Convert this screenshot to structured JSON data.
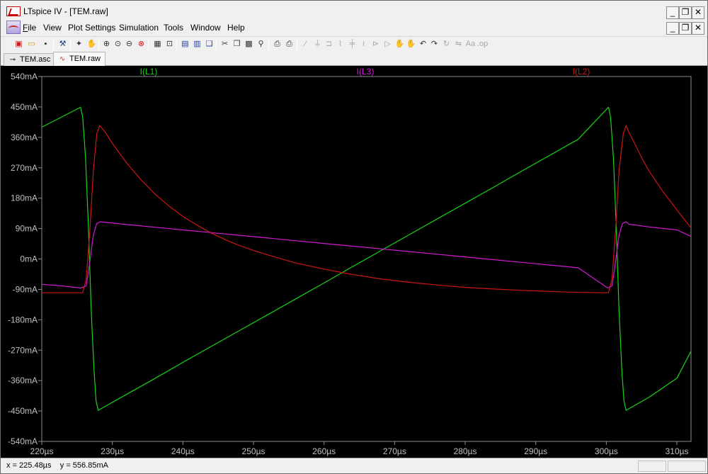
{
  "window": {
    "title": "LTspice IV - [TEM.raw]",
    "minimize": "_",
    "restore": "❐",
    "close": "✕"
  },
  "menu": [
    "File",
    "View",
    "Plot Settings",
    "Simulation",
    "Tools",
    "Window",
    "Help"
  ],
  "toolbar": {
    "icons": [
      "new-schematic",
      "open",
      "save",
      "control-panel",
      "run",
      "zoom-in",
      "pan",
      "zoom-out",
      "zoom-cancel",
      "autorange",
      "zoom-fit",
      "tile-horizontal",
      "tile-vertical",
      "cascade",
      "cut",
      "copy",
      "paste",
      "find",
      "print-preview",
      "print",
      "wire",
      "ground",
      "label",
      "resistor",
      "capacitor",
      "inductor",
      "diode",
      "component",
      "move",
      "drag",
      "undo",
      "redo",
      "rotate",
      "mirror",
      "text",
      "spice-directive"
    ]
  },
  "tabs": [
    {
      "label": "TEM.asc",
      "icon": "schematic-icon",
      "active": false
    },
    {
      "label": "TEM.raw",
      "icon": "waveform-icon",
      "active": true
    }
  ],
  "status": {
    "x_readout": "x = 225.48µs",
    "y_readout": "y = 556.85mA"
  },
  "colors": {
    "background": "#000000",
    "grid": "#8c8c8c",
    "axis_text": "#c0c0c0",
    "il1": "#19d219",
    "il3": "#d21ad2",
    "il2": "#cc1616"
  },
  "chart_data": {
    "type": "line",
    "xlabel": "",
    "ylabel": "",
    "x_unit": "µs",
    "y_unit": "mA",
    "xlim": [
      220,
      312
    ],
    "ylim": [
      -540,
      540
    ],
    "grid": false,
    "legend": "top",
    "x_ticks": [
      "220µs",
      "230µs",
      "240µs",
      "250µs",
      "260µs",
      "270µs",
      "280µs",
      "290µs",
      "300µs",
      "310µs"
    ],
    "x_tick_values": [
      220,
      230,
      240,
      250,
      260,
      270,
      280,
      290,
      300,
      310
    ],
    "y_ticks": [
      "540mA",
      "450mA",
      "360mA",
      "270mA",
      "180mA",
      "90mA",
      "0mA",
      "-90mA",
      "-180mA",
      "-270mA",
      "-360mA",
      "-450mA",
      "-540mA"
    ],
    "y_tick_values": [
      540,
      450,
      360,
      270,
      180,
      90,
      0,
      -90,
      -180,
      -270,
      -360,
      -450,
      -540
    ],
    "series": [
      {
        "name": "I(L1)",
        "color": "#19d219",
        "x": [
          220,
          225.5,
          225.8,
          226.2,
          226.6,
          227,
          227.4,
          227.7,
          228,
          232,
          236,
          240,
          244,
          248,
          252,
          256,
          260,
          264,
          268,
          272,
          276,
          280,
          284,
          288,
          292,
          296,
          300.3,
          300.6,
          301,
          301.4,
          301.8,
          302.2,
          302.5,
          302.8,
          306,
          310,
          313
        ],
        "y": [
          390,
          449,
          420,
          300,
          100,
          -150,
          -330,
          -420,
          -448,
          -401,
          -354,
          -306,
          -259,
          -212,
          -165,
          -118,
          -71,
          -23,
          24,
          71,
          118,
          165,
          212,
          260,
          307,
          354,
          449,
          420,
          300,
          100,
          -150,
          -330,
          -420,
          -448,
          -410,
          -353,
          -233
        ]
      },
      {
        "name": "I(L3)",
        "color": "#d21ad2",
        "x": [
          220,
          223,
          225.5,
          226.3,
          226.8,
          227.3,
          227.8,
          228.3,
          232,
          236,
          240,
          244,
          248,
          252,
          256,
          260,
          264,
          268,
          272,
          276,
          280,
          284,
          288,
          292,
          296,
          300.2,
          300.8,
          301.3,
          301.8,
          302.3,
          302.8,
          303.2,
          306,
          310,
          313
        ],
        "y": [
          -75,
          -80,
          -86,
          -80,
          -10,
          70,
          105,
          110,
          102,
          94,
          86,
          78,
          70,
          62,
          54,
          46,
          38,
          30,
          22,
          14,
          6,
          -2,
          -10,
          -18,
          -26,
          -86,
          -80,
          -10,
          70,
          105,
          110,
          103,
          95,
          86,
          57
        ]
      },
      {
        "name": "I(L2)",
        "color": "#cc1616",
        "x": [
          220,
          224,
          225.8,
          226.3,
          226.8,
          227.3,
          227.8,
          228.2,
          229,
          230,
          232,
          234,
          236,
          238,
          240,
          242,
          244,
          246,
          248,
          250,
          253,
          256,
          260,
          264,
          268,
          272,
          276,
          280,
          284,
          288,
          292,
          296,
          300.3,
          300.8,
          301.3,
          301.8,
          302.4,
          302.8,
          303.2,
          304,
          305,
          306,
          308,
          310,
          312,
          313
        ],
        "y": [
          -100,
          -100,
          -100,
          -60,
          80,
          260,
          370,
          395,
          375,
          342,
          285,
          236,
          193,
          157,
          126,
          100,
          77,
          57,
          40,
          25,
          6,
          -12,
          -30,
          -46,
          -59,
          -69,
          -77,
          -84,
          -89,
          -93,
          -96,
          -99,
          -100,
          -60,
          80,
          260,
          370,
          395,
          375,
          342,
          300,
          262,
          200,
          145,
          92,
          47
        ]
      }
    ]
  }
}
